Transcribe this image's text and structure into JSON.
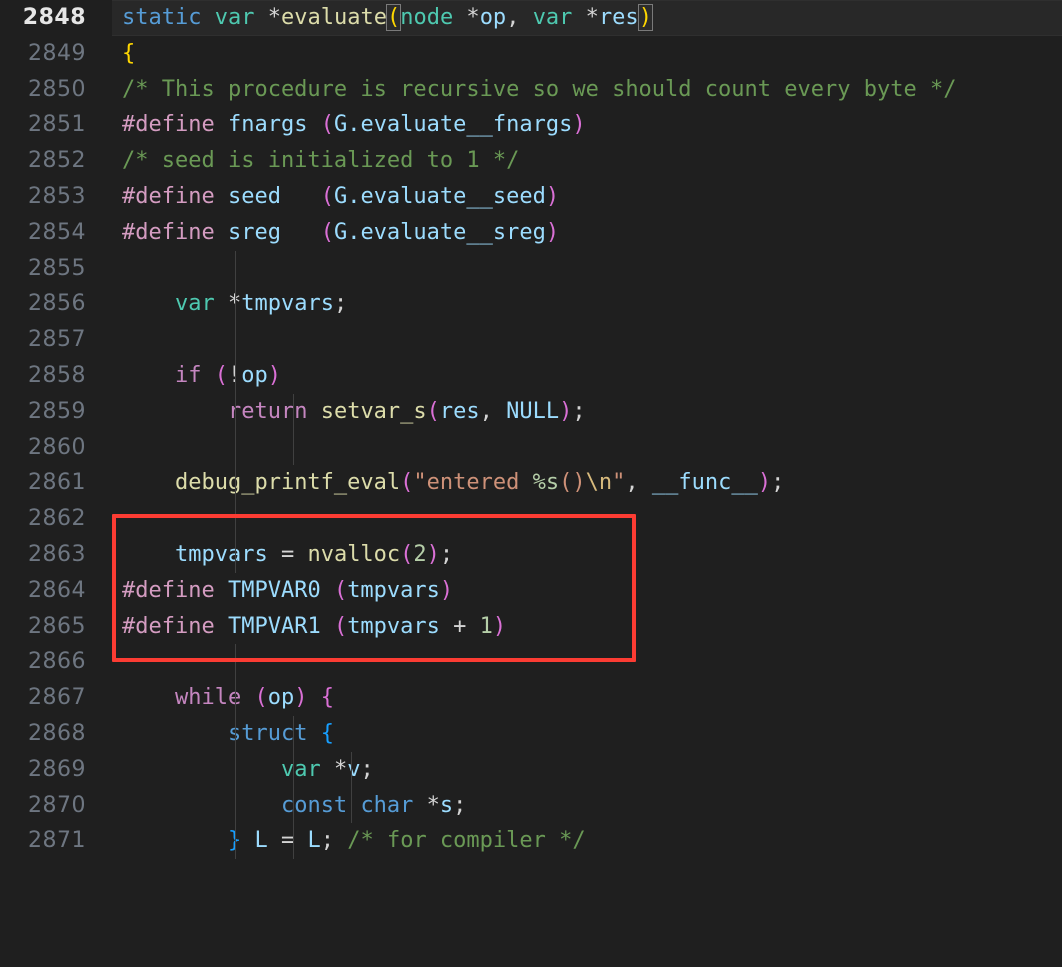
{
  "editor": {
    "theme": "dark-plus",
    "background": "#1F1F1F",
    "active_line_background": "#282828",
    "gutter_color": "#6E7681",
    "active_gutter_color": "#E6E6E6",
    "font_size_px": 22,
    "line_height_px": 35.8,
    "first_line_number": 2848,
    "last_line_number": 2871,
    "active_line_number": 2848
  },
  "annotation": {
    "type": "rectangle-highlight",
    "color": "#FC3C33",
    "border_width_px": 4,
    "covers_lines": [
      2862,
      2863,
      2864,
      2865,
      2866
    ]
  },
  "line_numbers": [
    "2848",
    "2849",
    "2850",
    "2851",
    "2852",
    "2853",
    "2854",
    "2855",
    "2856",
    "2857",
    "2858",
    "2859",
    "2860",
    "2861",
    "2862",
    "2863",
    "2864",
    "2865",
    "2866",
    "2867",
    "2868",
    "2869",
    "2870",
    "2871"
  ],
  "lines": [
    {
      "n": "2848",
      "text": "static var *evaluate(node *op, var *res)"
    },
    {
      "n": "2849",
      "text": "{"
    },
    {
      "n": "2850",
      "text": "/* This procedure is recursive so we should count every byte */"
    },
    {
      "n": "2851",
      "text": "#define fnargs (G.evaluate__fnargs)"
    },
    {
      "n": "2852",
      "text": "/* seed is initialized to 1 */"
    },
    {
      "n": "2853",
      "text": "#define seed   (G.evaluate__seed)"
    },
    {
      "n": "2854",
      "text": "#define sreg   (G.evaluate__sreg)"
    },
    {
      "n": "2855",
      "text": ""
    },
    {
      "n": "2856",
      "text": "    var *tmpvars;"
    },
    {
      "n": "2857",
      "text": ""
    },
    {
      "n": "2858",
      "text": "    if (!op)"
    },
    {
      "n": "2859",
      "text": "        return setvar_s(res, NULL);"
    },
    {
      "n": "2860",
      "text": ""
    },
    {
      "n": "2861",
      "text": "    debug_printf_eval(\"entered %s()\\n\", __func__);"
    },
    {
      "n": "2862",
      "text": ""
    },
    {
      "n": "2863",
      "text": "    tmpvars = nvalloc(2);"
    },
    {
      "n": "2864",
      "text": "#define TMPVAR0 (tmpvars)"
    },
    {
      "n": "2865",
      "text": "#define TMPVAR1 (tmpvars + 1)"
    },
    {
      "n": "2866",
      "text": ""
    },
    {
      "n": "2867",
      "text": "    while (op) {"
    },
    {
      "n": "2868",
      "text": "        struct {"
    },
    {
      "n": "2869",
      "text": "            var *v;"
    },
    {
      "n": "2870",
      "text": "            const char *s;"
    },
    {
      "n": "2871",
      "text": "        } L = L; /* for compiler */"
    }
  ],
  "tokens": {
    "l2848": [
      "static",
      "var",
      "*",
      "evaluate",
      "(",
      "node",
      "*",
      "op",
      ", ",
      "var",
      "*",
      "res",
      ")"
    ],
    "l2849": [
      "{"
    ],
    "l2850": [
      "/* This procedure is recursive so we should count every byte */"
    ],
    "l2851": [
      "#define",
      "fnargs",
      "(",
      "G",
      ".",
      "evaluate__fnargs",
      ")"
    ],
    "l2852": [
      "/* seed is initialized to 1 */"
    ],
    "l2853": [
      "#define",
      "seed",
      "(",
      "G",
      ".",
      "evaluate__seed",
      ")"
    ],
    "l2854": [
      "#define",
      "sreg",
      "(",
      "G",
      ".",
      "evaluate__sreg",
      ")"
    ],
    "l2856": [
      "var",
      "*",
      "tmpvars",
      ";"
    ],
    "l2858": [
      "if",
      "(",
      "!",
      "op",
      ")"
    ],
    "l2859": [
      "return",
      "setvar_s",
      "(",
      "res",
      ", ",
      "NULL",
      ")",
      ";"
    ],
    "l2861": [
      "debug_printf_eval",
      "(",
      "\"entered %s()\\n\"",
      ", ",
      "__func__",
      ")",
      ";"
    ],
    "l2863": [
      "tmpvars",
      " = ",
      "nvalloc",
      "(",
      "2",
      ")",
      ";"
    ],
    "l2864": [
      "#define",
      "TMPVAR0",
      "(",
      "tmpvars",
      ")"
    ],
    "l2865": [
      "#define",
      "TMPVAR1",
      "(",
      "tmpvars",
      " + ",
      "1",
      ")"
    ],
    "l2867": [
      "while",
      "(",
      "op",
      ")",
      "{"
    ],
    "l2868": [
      "struct",
      "{"
    ],
    "l2869": [
      "var",
      "*",
      "v",
      ";"
    ],
    "l2870": [
      "const",
      "char",
      "*",
      "s",
      ";"
    ],
    "l2871": [
      "}",
      "L",
      " = ",
      "L",
      ";",
      "/* for compiler */"
    ]
  },
  "palette": {
    "control_keyword": "#C586C0",
    "type_keyword": "#569CD6",
    "user_type": "#4EC9B0",
    "function": "#DCDCAA",
    "identifier": "#9CDCFE",
    "preprocessor": "#D49CC1",
    "comment": "#6A9955",
    "string": "#CE9178",
    "escape": "#D7BA7D",
    "number": "#B5CEA8",
    "operator": "#D4D4D4",
    "bracket_1": "#FFD700",
    "bracket_2": "#DA70D6",
    "bracket_3": "#179FFF",
    "annotation_red": "#FC3C33"
  }
}
